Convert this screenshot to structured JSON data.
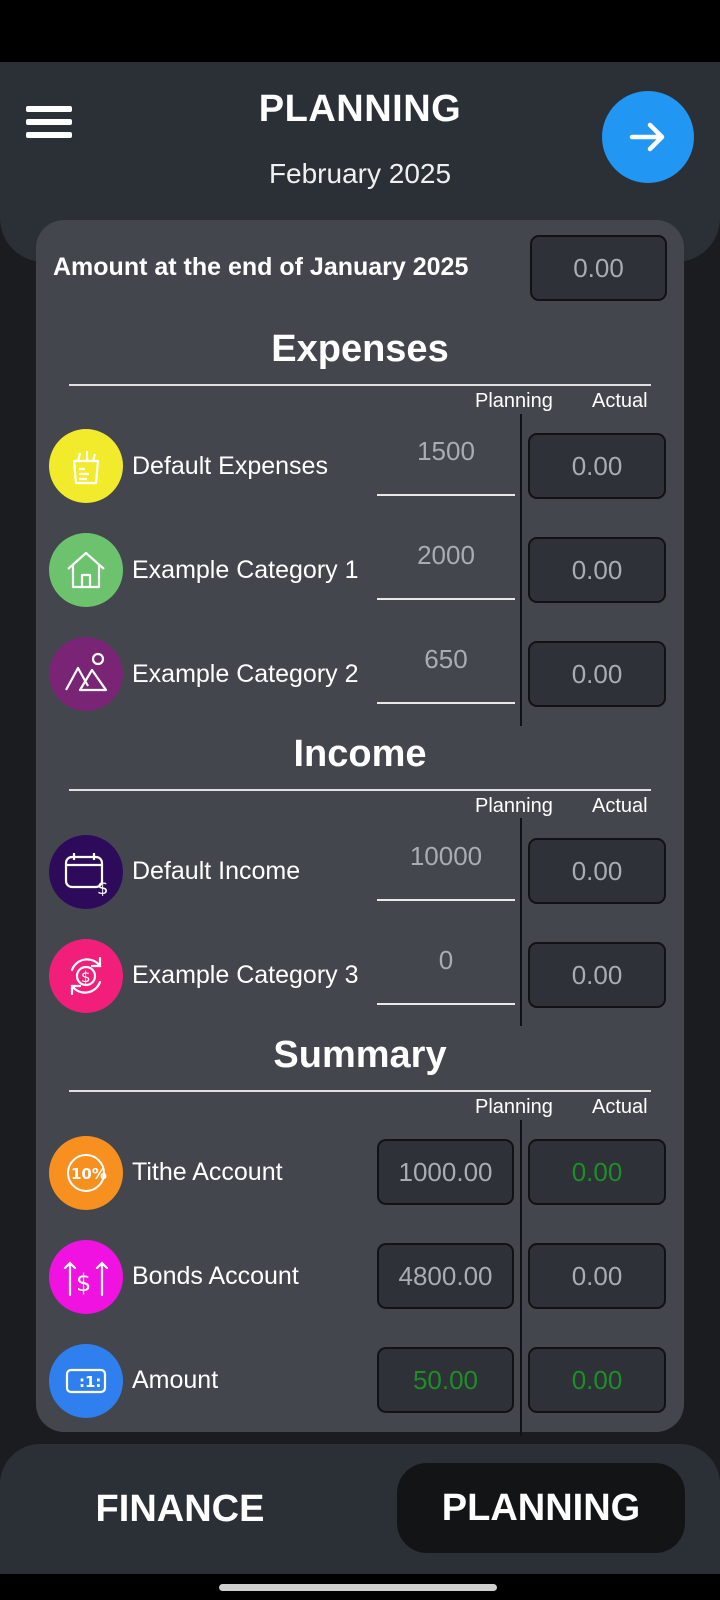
{
  "header": {
    "title": "PLANNING",
    "subtitle": "February 2025",
    "menu_icon": "hamburger-menu-icon",
    "next_icon": "arrow-right-icon"
  },
  "opening": {
    "label": "Amount at the end of January 2025",
    "value": "0.00"
  },
  "columns": {
    "planning": "Planning",
    "actual": "Actual"
  },
  "expenses": {
    "title": "Expenses",
    "items": [
      {
        "name": "Default Expenses",
        "planning": "1500",
        "actual": "0.00",
        "icon": "grocery-bag-icon",
        "color": "#f2eb2c"
      },
      {
        "name": "Example Category 1",
        "planning": "2000",
        "actual": "0.00",
        "icon": "house-icon",
        "color": "#6cc26d"
      },
      {
        "name": "Example Category 2",
        "planning": "650",
        "actual": "0.00",
        "icon": "shapes-icon",
        "color": "#7a2475"
      }
    ]
  },
  "income": {
    "title": "Income",
    "items": [
      {
        "name": "Default Income",
        "planning": "10000",
        "actual": "0.00",
        "icon": "wallet-dollar-icon",
        "color": "#2e0a5a"
      },
      {
        "name": "Example Category 3",
        "planning": "0",
        "actual": "0.00",
        "icon": "dollar-exchange-icon",
        "color": "#f21f7a"
      }
    ]
  },
  "summary": {
    "title": "Summary",
    "items": [
      {
        "name": "Tithe Account",
        "planning": "1000.00",
        "actual": "0.00",
        "icon": "percent-badge-icon",
        "color": "#f7901e",
        "actual_color": "#1e8e24"
      },
      {
        "name": "Bonds Account",
        "planning": "4800.00",
        "actual": "0.00",
        "icon": "dollar-growth-icon",
        "color": "#f012e0"
      },
      {
        "name": "Amount",
        "planning": "50.00",
        "actual": "0.00",
        "icon": "banknote-icon",
        "color": "#2f80ee",
        "planning_color": "#1e8e24",
        "actual_color": "#1e8e24"
      }
    ]
  },
  "nav": {
    "finance": "FINANCE",
    "planning": "PLANNING"
  }
}
